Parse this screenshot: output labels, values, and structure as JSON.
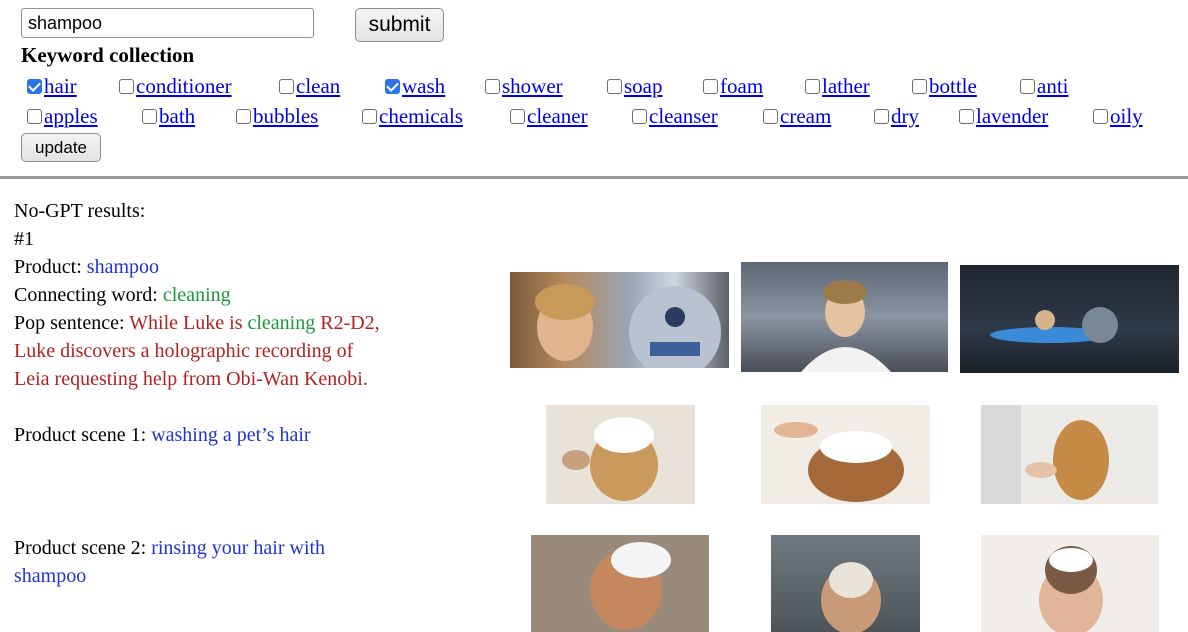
{
  "search": {
    "value": "shampoo"
  },
  "buttons": {
    "submit": "submit",
    "update": "update"
  },
  "keywords": {
    "heading": "Keyword collection",
    "row1": [
      {
        "label": "hair",
        "checked": true
      },
      {
        "label": "conditioner",
        "checked": false
      },
      {
        "label": "clean",
        "checked": false
      },
      {
        "label": "wash",
        "checked": true
      },
      {
        "label": "shower",
        "checked": false
      },
      {
        "label": "soap",
        "checked": false
      },
      {
        "label": "foam",
        "checked": false
      },
      {
        "label": "lather",
        "checked": false
      },
      {
        "label": "bottle",
        "checked": false
      },
      {
        "label": "anti",
        "checked": false
      }
    ],
    "row2": [
      {
        "label": "apples",
        "checked": false
      },
      {
        "label": "bath",
        "checked": false
      },
      {
        "label": "bubbles",
        "checked": false
      },
      {
        "label": "chemicals",
        "checked": false
      },
      {
        "label": "cleaner",
        "checked": false
      },
      {
        "label": "cleanser",
        "checked": false
      },
      {
        "label": "cream",
        "checked": false
      },
      {
        "label": "dry",
        "checked": false
      },
      {
        "label": "lavender",
        "checked": false
      },
      {
        "label": "oily",
        "checked": false
      }
    ]
  },
  "results": {
    "header": "No-GPT results:",
    "index": "#1",
    "product_label": "Product: ",
    "product": "shampoo",
    "connecting_label": "Connecting word: ",
    "connecting_word": "cleaning",
    "pop_label": "Pop sentence: ",
    "pop_part1": "While Luke is ",
    "pop_word": "cleaning",
    "pop_part2": " R2-D2,",
    "pop_line2": "Luke discovers a holographic recording of",
    "pop_line3": "Leia requesting help from Obi-Wan Kenobi.",
    "scene1_label": "Product scene 1: ",
    "scene1": "washing a pet’s hair",
    "scene2_label": "Product scene 2: ",
    "scene2_line1": "rinsing your hair with",
    "scene2_line2": "shampoo"
  },
  "colors": {
    "link": "#0000ee",
    "blue_text": "#1f33d6",
    "green_text": "#1a9a3a",
    "red_text": "#b22222",
    "checkbox": "#2a73e8"
  }
}
